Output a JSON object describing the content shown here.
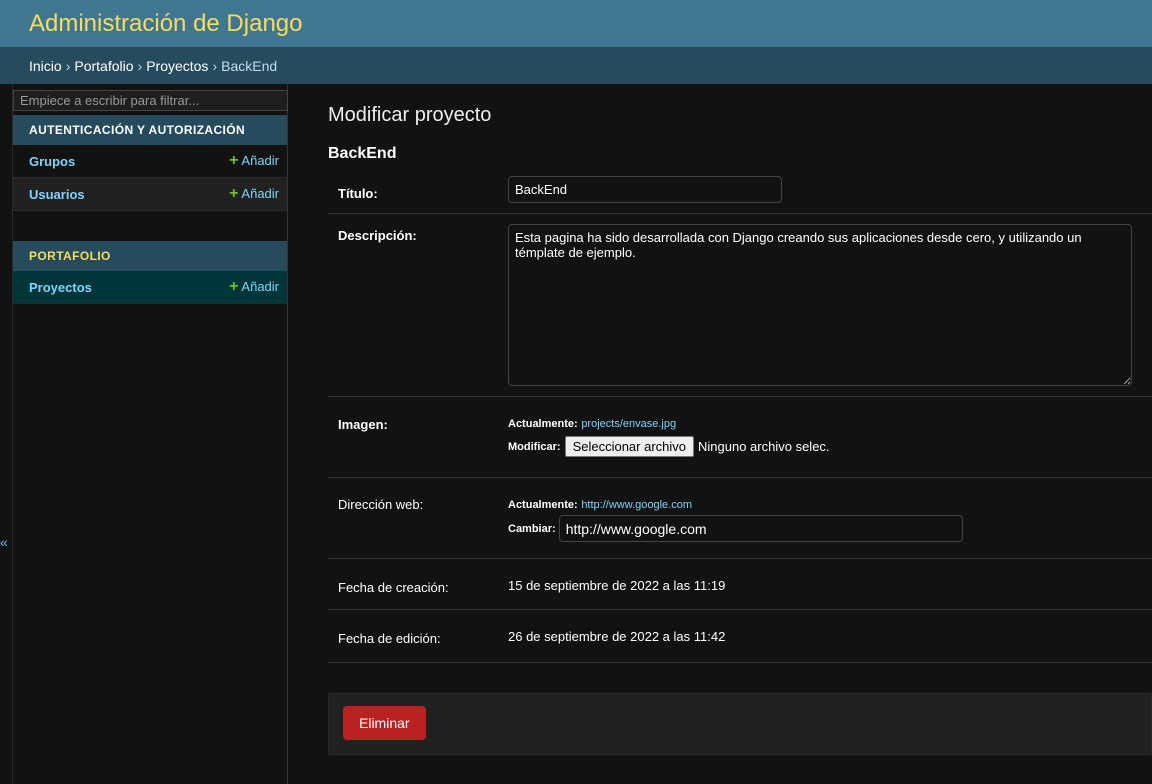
{
  "header": {
    "title": "Administración de Django"
  },
  "breadcrumbs": [
    "Inicio",
    "Portafolio",
    "Proyectos",
    "BackEnd"
  ],
  "breadcrumb_sep": "›",
  "sidebar": {
    "filter_placeholder": "Empiece a escribir para filtrar...",
    "toggle": "«",
    "apps": [
      {
        "caption": "AUTENTICACIÓN Y AUTORIZACIÓN",
        "models": [
          {
            "name": "Grupos",
            "add": "Añadir"
          },
          {
            "name": "Usuarios",
            "add": "Añadir"
          }
        ]
      },
      {
        "caption": "PORTAFOLIO",
        "models": [
          {
            "name": "Proyectos",
            "add": "Añadir"
          }
        ]
      }
    ]
  },
  "main": {
    "title": "Modificar proyecto",
    "object": "BackEnd",
    "fields": {
      "titulo": {
        "label": "Título:",
        "value": "BackEnd"
      },
      "descripcion": {
        "label": "Descripción:",
        "value": "Esta pagina ha sido desarrollada con Django creando sus aplicaciones desde cero, y utilizando un témplate de ejemplo."
      },
      "imagen": {
        "label": "Imagen:",
        "current_label": "Actualmente:",
        "current": "projects/envase.jpg",
        "change_label": "Modificar:",
        "button": "Seleccionar archivo",
        "no_file": "Ninguno archivo selec."
      },
      "web": {
        "label": "Dirección web:",
        "current_label": "Actualmente:",
        "current": "http://www.google.com",
        "change_label": "Cambiar:",
        "value": "http://www.google.com"
      },
      "creacion": {
        "label": "Fecha de creación:",
        "value": "15 de septiembre de 2022 a las 11:19"
      },
      "edicion": {
        "label": "Fecha de edición:",
        "value": "26 de septiembre de 2022 a las 11:42"
      }
    },
    "delete": "Eliminar"
  }
}
